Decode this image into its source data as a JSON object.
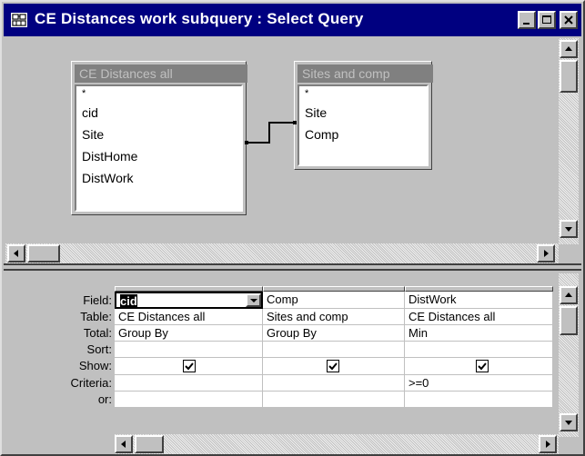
{
  "window": {
    "title": "CE Distances work subquery : Select Query"
  },
  "tables": [
    {
      "name": "CE Distances all",
      "fields": [
        "*",
        "cid",
        "Site",
        "DistHome",
        "DistWork"
      ]
    },
    {
      "name": "Sites and comp",
      "fields": [
        "*",
        "Site",
        "Comp"
      ]
    }
  ],
  "grid": {
    "row_labels": [
      "Field:",
      "Table:",
      "Total:",
      "Sort:",
      "Show:",
      "Criteria:",
      "or:"
    ],
    "columns": [
      {
        "field": "cid",
        "table": "CE Distances all",
        "total": "Group By",
        "sort": "",
        "show": true,
        "criteria": "",
        "or": ""
      },
      {
        "field": "Comp",
        "table": "Sites and comp",
        "total": "Group By",
        "sort": "",
        "show": true,
        "criteria": "",
        "or": ""
      },
      {
        "field": "DistWork",
        "table": "CE Distances all",
        "total": "Min",
        "sort": "",
        "show": true,
        "criteria": ">=0",
        "or": ""
      }
    ]
  },
  "colors": {
    "titlebar": "#000080",
    "face": "#c0c0c0",
    "inactive_table_header": "#808080"
  }
}
